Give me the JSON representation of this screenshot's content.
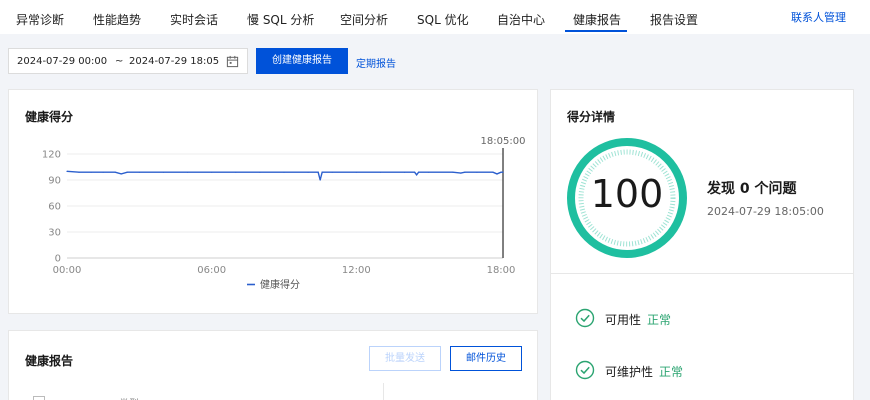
{
  "nav": {
    "tabs": [
      {
        "label": "异常诊断"
      },
      {
        "label": "性能趋势"
      },
      {
        "label": "实时会话"
      },
      {
        "label": "慢 SQL 分析"
      },
      {
        "label": "空间分析"
      },
      {
        "label": "SQL 优化"
      },
      {
        "label": "自治中心"
      },
      {
        "label": "健康报告",
        "active": true
      },
      {
        "label": "报告设置"
      }
    ],
    "contact_link": "联系人管理"
  },
  "toolbar": {
    "date_start": "2024-07-29 00:00",
    "date_separator": "~",
    "date_end": "2024-07-29 18:05",
    "create_button": "创建健康报告",
    "schedule_link": "定期报告"
  },
  "health_chart": {
    "title": "健康得分",
    "cursor_label": "18:05:00",
    "chart_data": {
      "type": "line",
      "x": [
        "00:00",
        "00:30",
        "01:00",
        "01:30",
        "02:00",
        "02:15",
        "02:30",
        "03:00",
        "04:00",
        "05:00",
        "06:00",
        "07:00",
        "08:00",
        "09:00",
        "10:00",
        "10:25",
        "10:30",
        "10:35",
        "11:00",
        "12:00",
        "13:00",
        "14:00",
        "14:25",
        "14:30",
        "14:35",
        "15:00",
        "16:00",
        "16:20",
        "16:30",
        "17:00",
        "17:40",
        "17:50",
        "18:00",
        "18:05"
      ],
      "series": [
        {
          "name": "健康得分",
          "values": [
            100,
            99,
            99,
            99,
            99,
            97,
            99,
            99,
            99,
            99,
            99,
            99,
            99,
            99,
            99,
            99,
            90,
            99,
            99,
            99,
            99,
            99,
            99,
            96,
            99,
            99,
            99,
            98,
            99,
            99,
            99,
            97,
            99,
            99
          ]
        }
      ],
      "x_ticks": [
        "00:00",
        "06:00",
        "12:00",
        "18:00"
      ],
      "y_ticks": [
        0,
        30,
        60,
        90,
        120
      ],
      "ylim": [
        0,
        120
      ],
      "grid": true,
      "legend": "bottom",
      "color": "#2b5fcd"
    }
  },
  "score_detail": {
    "title": "得分详情",
    "score": "100",
    "issues_text": "发现 0 个问题",
    "timestamp": "2024-07-29 18:05:00",
    "ring_color": "#1fbfa0",
    "items": [
      {
        "name": "可用性",
        "status": "正常"
      },
      {
        "name": "可维护性",
        "status": "正常"
      }
    ]
  },
  "report": {
    "title": "健康报告",
    "batch_send": "批量发送",
    "mail_history": "邮件历史",
    "columns": [
      "类型"
    ]
  }
}
